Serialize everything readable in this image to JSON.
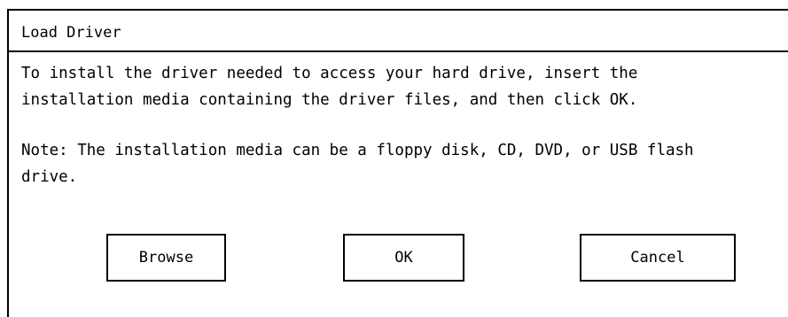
{
  "dialog": {
    "title": "Load Driver",
    "message_line1": "To install the driver needed to access your hard drive, insert the",
    "message_line2": "installation media containing the driver files, and then click OK.",
    "note_line1": "Note: The installation media can be a floppy disk, CD, DVD, or USB flash",
    "note_line2": "drive."
  },
  "buttons": {
    "browse": "Browse",
    "ok": "OK",
    "cancel": "Cancel"
  }
}
